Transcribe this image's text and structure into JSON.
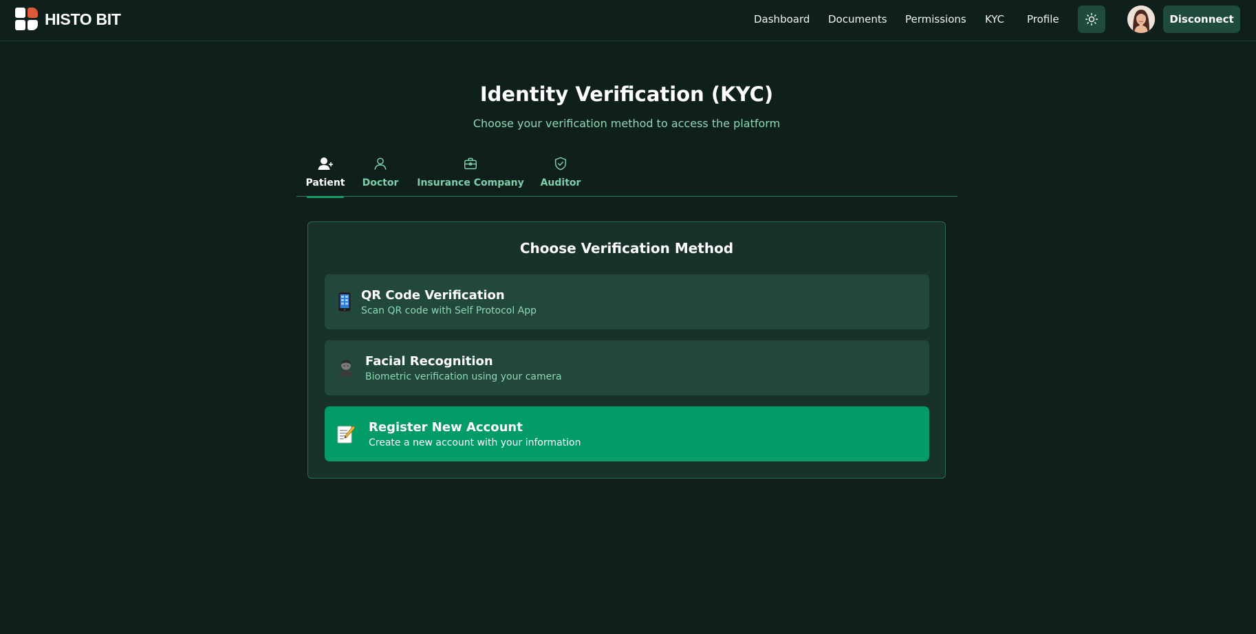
{
  "brand": {
    "name": "HISTO BIT"
  },
  "nav": {
    "links": [
      "Dashboard",
      "Documents",
      "Permissions",
      "KYC",
      "Profile"
    ],
    "disconnect_label": "Disconnect"
  },
  "page": {
    "title": "Identity Verification (KYC)",
    "subtitle": "Choose your verification method to access the platform"
  },
  "tabs": [
    {
      "label": "Patient",
      "icon": "user-plus-icon",
      "active": true
    },
    {
      "label": "Doctor",
      "icon": "user-icon",
      "active": false
    },
    {
      "label": "Insurance Company",
      "icon": "briefcase-icon",
      "active": false
    },
    {
      "label": "Auditor",
      "icon": "shield-check-icon",
      "active": false
    }
  ],
  "card": {
    "title": "Choose Verification Method",
    "options": [
      {
        "title": "QR Code Verification",
        "description": "Scan QR code with Self Protocol App",
        "icon": "mobile-phone-icon"
      },
      {
        "title": "Facial Recognition",
        "description": "Biometric verification using your camera",
        "icon": "face-scan-icon"
      },
      {
        "title": "Register New Account",
        "description": "Create a new account with your information",
        "icon": "memo-icon"
      }
    ]
  },
  "colors": {
    "background": "#0f201c",
    "accent": "#039b66",
    "muted_text": "#8fd9b5"
  }
}
